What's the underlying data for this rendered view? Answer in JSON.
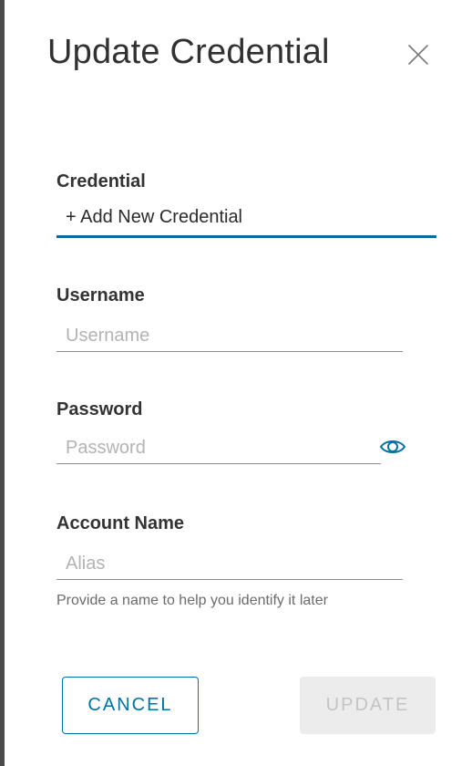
{
  "dialog": {
    "title": "Update Credential",
    "close_icon": "close-icon"
  },
  "credential": {
    "label": "Credential",
    "selected_value": "+ Add New Credential"
  },
  "username": {
    "label": "Username",
    "value": "",
    "placeholder": "Username"
  },
  "password": {
    "label": "Password",
    "value": "",
    "placeholder": "Password",
    "toggle_icon": "eye-icon"
  },
  "account_name": {
    "label": "Account Name",
    "value": "",
    "placeholder": "Alias",
    "help_text": "Provide a name to help you identify it later"
  },
  "buttons": {
    "cancel_label": "CANCEL",
    "update_label": "UPDATE",
    "update_disabled": true
  },
  "colors": {
    "accent": "#0072a3",
    "select_underline": "#0b6aa2",
    "disabled_bg": "#ececec",
    "disabled_text": "#c4c4c4"
  }
}
